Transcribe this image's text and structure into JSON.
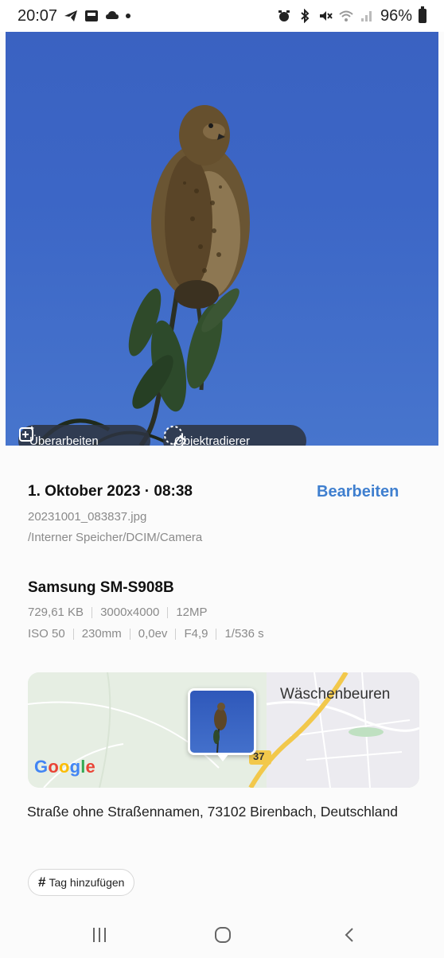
{
  "status_bar": {
    "time": "20:07",
    "battery": "96%"
  },
  "photo_actions": {
    "enhance_label": "Überarbeiten",
    "eraser_label": "Objektradierer"
  },
  "details": {
    "date": "1. Oktober 2023 · 08:38",
    "edit_label": "Bearbeiten",
    "filename": "20231001_083837.jpg",
    "path": "/Interner Speicher/DCIM/Camera",
    "device": "Samsung SM-S908B",
    "file_specs": [
      "729,61 KB",
      "3000x4000",
      "12MP"
    ],
    "camera_specs": [
      "ISO 50",
      "230mm",
      "0,0ev",
      "F4,9",
      "1/536 s"
    ]
  },
  "map": {
    "place_label": "Wäschenbeuren",
    "road_number": "37",
    "provider": "Google",
    "address": "Straße ohne Straßennamen, 73102 Birenbach, Deutschland"
  },
  "tags": {
    "add_label": "Tag hinzufügen"
  },
  "colors": {
    "accent": "#3f7fcf",
    "sky": "#3c66c6"
  }
}
